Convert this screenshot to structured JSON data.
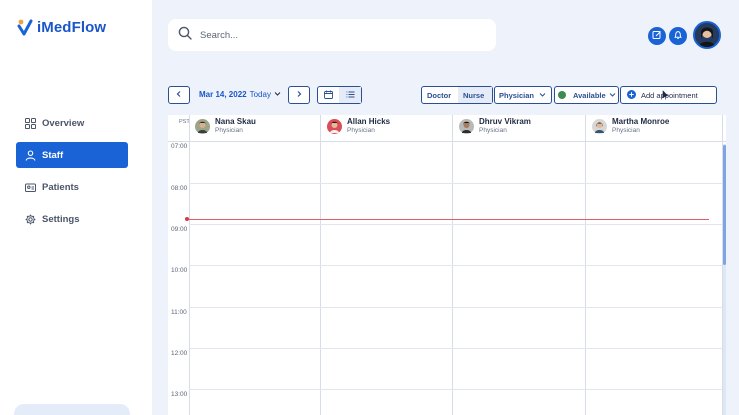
{
  "app": {
    "name": "iMedFlow"
  },
  "nav": {
    "items": [
      {
        "label": "Overview",
        "icon": "grid-icon"
      },
      {
        "label": "Staff",
        "icon": "person-icon",
        "active": true
      },
      {
        "label": "Patients",
        "icon": "id-card-icon"
      },
      {
        "label": "Settings",
        "icon": "gear-icon"
      }
    ]
  },
  "search": {
    "placeholder": "Search...",
    "value": ""
  },
  "toolbar": {
    "date": "Mar 14, 2022",
    "today": "Today",
    "role_tabs": [
      "Doctor",
      "Nurse"
    ],
    "role_filter": "Physician",
    "availability": "Available",
    "add_label": "Add appointment"
  },
  "calendar": {
    "timezone": "PST",
    "staff": [
      {
        "name": "Nana Skau",
        "role": "Physician"
      },
      {
        "name": "Allan Hicks",
        "role": "Physician"
      },
      {
        "name": "Dhruv Vikram",
        "role": "Physician"
      },
      {
        "name": "Martha Monroe",
        "role": "Physician"
      }
    ],
    "times": [
      "07:00",
      "08:00",
      "09:00",
      "10:00",
      "11:00",
      "12:00",
      "13:00"
    ]
  },
  "colors": {
    "accent": "#1a63d6",
    "brand": "#1a56c8",
    "now_line": "#e05c6a",
    "available": "#3e8a4f"
  }
}
